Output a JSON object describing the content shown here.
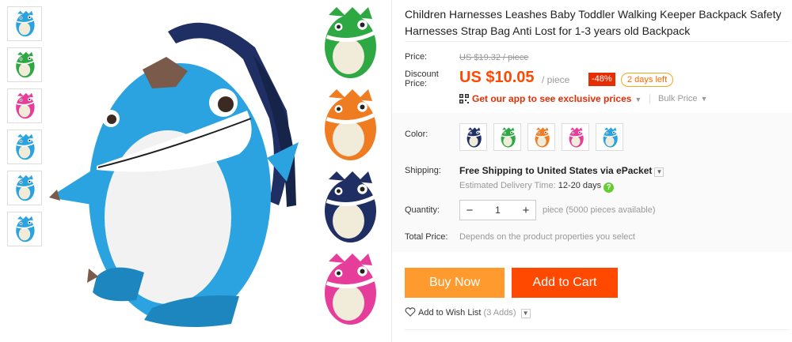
{
  "product": {
    "title": "Children Harnesses Leashes Baby Toddler Walking Keeper Backpack Safety Harnesses Strap Bag Anti Lost for 1-3 years old Backpack"
  },
  "gallery": {
    "thumbnails": [
      "blue-backpack",
      "green-backpack",
      "pink-backpack",
      "blue-backpack-side",
      "blue-backpack-back",
      "blue-backpack-top"
    ],
    "variants": [
      "green",
      "orange",
      "navy",
      "pink"
    ]
  },
  "price": {
    "label": "Price:",
    "original": "US $19.32 / piece",
    "discount_label": "Discount Price:",
    "current": "US $10.05",
    "unit": "/ piece",
    "discount_pct": "-48%",
    "time_left": "2 days left",
    "app_promo": "Get our app to see exclusive prices",
    "bulk": "Bulk Price"
  },
  "options": {
    "color_label": "Color:",
    "colors": [
      "navy",
      "green",
      "orange",
      "pink",
      "blue"
    ],
    "shipping_label": "Shipping:",
    "shipping_text": "Free Shipping to United States via ePacket",
    "delivery_prefix": "Estimated Delivery Time:",
    "delivery_days": "12-20 days",
    "quantity_label": "Quantity:",
    "quantity_value": "1",
    "quantity_minus": "−",
    "quantity_plus": "+",
    "availability": "piece (5000 pieces available)",
    "total_label": "Total Price:",
    "total_text": "Depends on the product properties you select"
  },
  "actions": {
    "buy_now": "Buy Now",
    "add_to_cart": "Add to Cart",
    "wish_list": "Add to Wish List",
    "wish_count": "(3 Adds)"
  },
  "colors": {
    "accent": "#ff4800",
    "buy_button": "#ff9a2e",
    "discount_badge": "#e62e04",
    "blue": "#2aa3e0",
    "green": "#2ea843",
    "orange": "#f07c22",
    "navy": "#1f2f64",
    "pink": "#e63c9a"
  }
}
